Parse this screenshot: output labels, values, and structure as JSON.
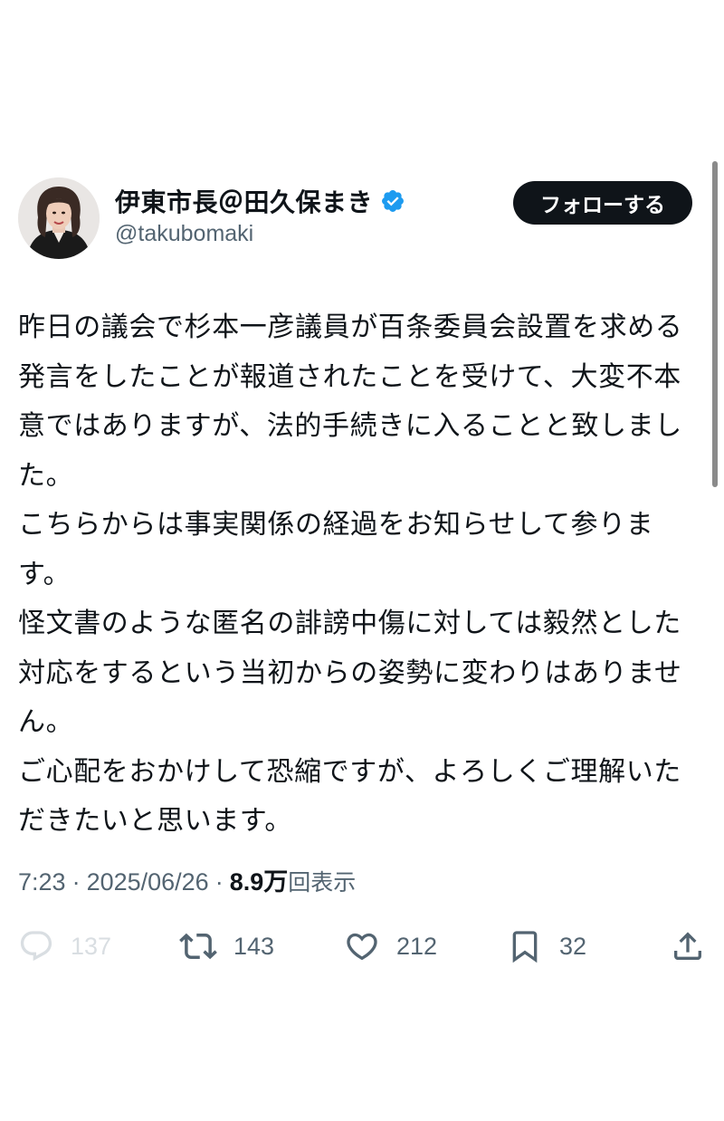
{
  "user": {
    "display_name": "伊東市長＠田久保まき",
    "handle": "@takubomaki",
    "verified": true,
    "accent_color": "#1d9bf0"
  },
  "follow_button": {
    "label": "フォローする"
  },
  "tweet": {
    "text": "昨日の議会で杉本一彦議員が百条委員会設置を求める発言をしたことが報道されたことを受けて、大変不本意ではありますが、法的手続きに入ることと致しました。\nこちらからは事実関係の経過をお知らせして参ります。\n怪文書のような匿名の誹謗中傷に対しては毅然とした対応をするという当初からの姿勢に変わりはありません。\nご心配をおかけして恐縮ですが、よろしくご理解いただきたいと思います。"
  },
  "meta": {
    "time": "7:23",
    "separator": "·",
    "date": "2025/06/26",
    "views_count": "8.9万",
    "views_label": "回表示"
  },
  "actions": {
    "reply": {
      "icon": "reply-icon",
      "count": "137"
    },
    "retweet": {
      "icon": "retweet-icon",
      "count": "143"
    },
    "like": {
      "icon": "heart-icon",
      "count": "212"
    },
    "bookmark": {
      "icon": "bookmark-icon",
      "count": "32"
    },
    "share": {
      "icon": "share-icon"
    }
  }
}
